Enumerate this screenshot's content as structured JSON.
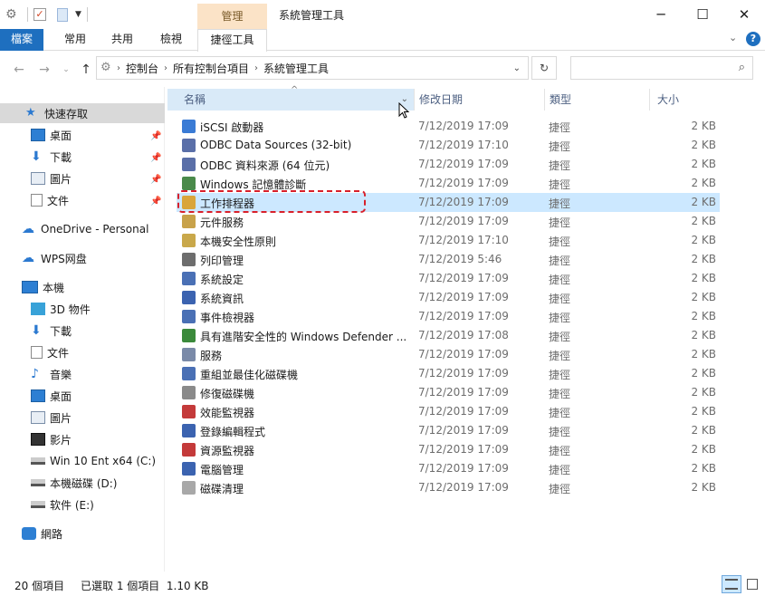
{
  "window": {
    "title": "系統管理工具",
    "context_tab_group": "管理"
  },
  "ribbon": {
    "tabs": [
      "檔案",
      "常用",
      "共用",
      "檢視",
      "捷徑工具"
    ]
  },
  "address": {
    "crumbs": [
      "控制台",
      "所有控制台項目",
      "系統管理工具"
    ],
    "search_placeholder": ""
  },
  "nav": {
    "quick_access": "快速存取",
    "quick_items": [
      "桌面",
      "下載",
      "圖片",
      "文件"
    ],
    "onedrive": "OneDrive - Personal",
    "wps": "WPS网盘",
    "this_pc": "本機",
    "pc_items": [
      "3D 物件",
      "下載",
      "文件",
      "音樂",
      "桌面",
      "圖片",
      "影片",
      "Win 10 Ent x64 (C:)",
      "本機磁碟 (D:)",
      "软件 (E:)"
    ],
    "network": "網路"
  },
  "columns": {
    "name": "名稱",
    "date": "修改日期",
    "type": "類型",
    "size": "大小"
  },
  "files": [
    {
      "name": "iSCSI 啟動器",
      "date": "7/12/2019 17:09",
      "type": "捷徑",
      "size": "2 KB",
      "color": "#3a7bd5"
    },
    {
      "name": "ODBC Data Sources (32-bit)",
      "date": "7/12/2019 17:10",
      "type": "捷徑",
      "size": "2 KB",
      "color": "#5a6fa8"
    },
    {
      "name": "ODBC 資料來源 (64 位元)",
      "date": "7/12/2019 17:09",
      "type": "捷徑",
      "size": "2 KB",
      "color": "#5a6fa8"
    },
    {
      "name": "Windows 記憶體診斷",
      "date": "7/12/2019 17:09",
      "type": "捷徑",
      "size": "2 KB",
      "color": "#4a8a4a"
    },
    {
      "name": "工作排程器",
      "date": "7/12/2019 17:09",
      "type": "捷徑",
      "size": "2 KB",
      "color": "#d9a53a"
    },
    {
      "name": "元件服務",
      "date": "7/12/2019 17:09",
      "type": "捷徑",
      "size": "2 KB",
      "color": "#c8a24a"
    },
    {
      "name": "本機安全性原則",
      "date": "7/12/2019 17:10",
      "type": "捷徑",
      "size": "2 KB",
      "color": "#c9a84a"
    },
    {
      "name": "列印管理",
      "date": "7/12/2019 5:46",
      "type": "捷徑",
      "size": "2 KB",
      "color": "#6d6d6d"
    },
    {
      "name": "系統設定",
      "date": "7/12/2019 17:09",
      "type": "捷徑",
      "size": "2 KB",
      "color": "#4a70b5"
    },
    {
      "name": "系統資訊",
      "date": "7/12/2019 17:09",
      "type": "捷徑",
      "size": "2 KB",
      "color": "#3b63b0"
    },
    {
      "name": "事件檢視器",
      "date": "7/12/2019 17:09",
      "type": "捷徑",
      "size": "2 KB",
      "color": "#4a70b5"
    },
    {
      "name": "具有進階安全性的 Windows Defender ...",
      "date": "7/12/2019 17:08",
      "type": "捷徑",
      "size": "2 KB",
      "color": "#3b8a3b"
    },
    {
      "name": "服務",
      "date": "7/12/2019 17:09",
      "type": "捷徑",
      "size": "2 KB",
      "color": "#7a8aa8"
    },
    {
      "name": "重組並最佳化磁碟機",
      "date": "7/12/2019 17:09",
      "type": "捷徑",
      "size": "2 KB",
      "color": "#4a70b5"
    },
    {
      "name": "修復磁碟機",
      "date": "7/12/2019 17:09",
      "type": "捷徑",
      "size": "2 KB",
      "color": "#8a8a8a"
    },
    {
      "name": "效能監視器",
      "date": "7/12/2019 17:09",
      "type": "捷徑",
      "size": "2 KB",
      "color": "#c43a3a"
    },
    {
      "name": "登錄編輯程式",
      "date": "7/12/2019 17:09",
      "type": "捷徑",
      "size": "2 KB",
      "color": "#3b63b0"
    },
    {
      "name": "資源監視器",
      "date": "7/12/2019 17:09",
      "type": "捷徑",
      "size": "2 KB",
      "color": "#c43a3a"
    },
    {
      "name": "電腦管理",
      "date": "7/12/2019 17:09",
      "type": "捷徑",
      "size": "2 KB",
      "color": "#3b63b0"
    },
    {
      "name": "磁碟清理",
      "date": "7/12/2019 17:09",
      "type": "捷徑",
      "size": "2 KB",
      "color": "#a8a8a8"
    }
  ],
  "selected_index": 4,
  "status": {
    "count": "20 個項目",
    "selection": "已選取 1 個項目  1.10 KB"
  }
}
